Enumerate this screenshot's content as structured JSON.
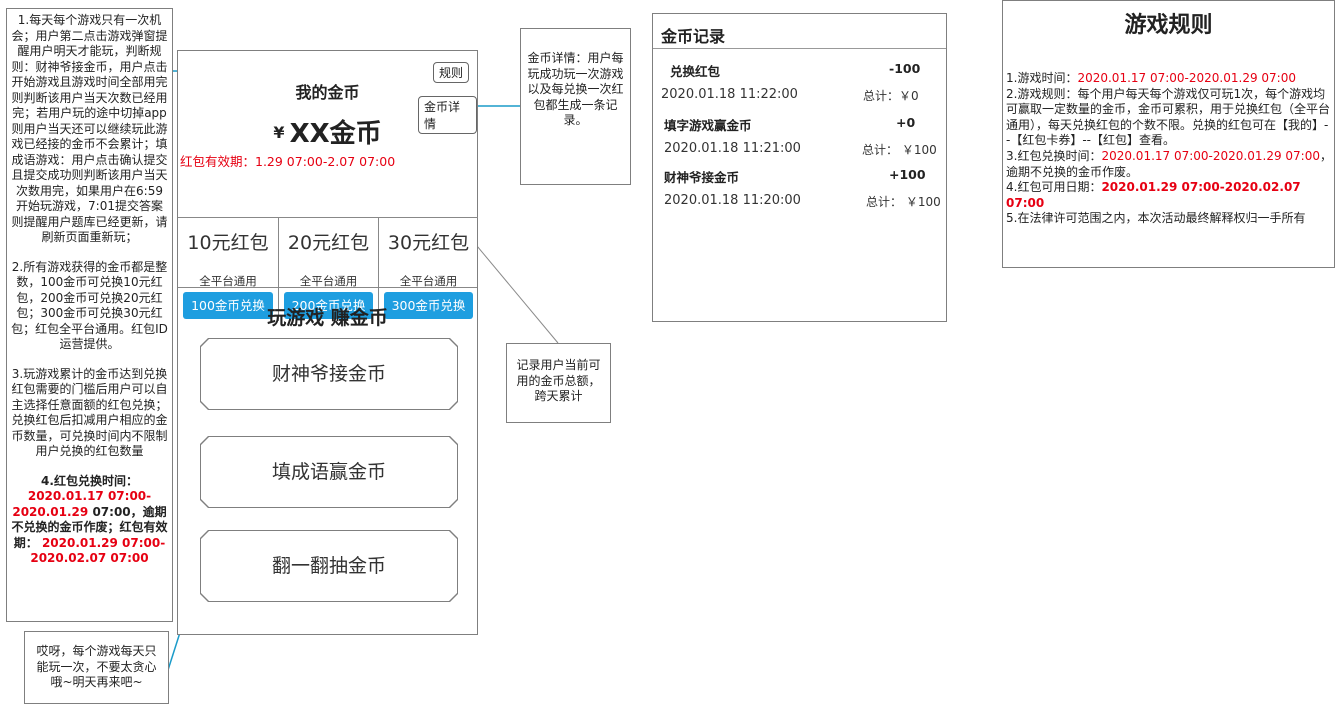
{
  "left_note": {
    "p1": "1.每天每个游戏只有一次机会；用户第二点击游戏弹窗提醒用户明天才能玩，判断规则：财神爷接金币，用户点击开始游戏且游戏时间全部用完则判断该用户当天次数已经用完；若用户玩的途中切掉app则用户当天还可以继续玩此游戏已经接的金币不会累计；填成语游戏：用户点击确认提交且提交成功则判断该用户当天次数用完，如果用户在6:59开始玩游戏，7:01提交答案则提醒用户题库已经更新，请刷新页面重新玩；",
    "p2": "2.所有游戏获得的金币都是整数，100金币可兑换10元红包，200金币可兑换20元红包；300金币可兑换30元红包；红包全平台通用。红包ID运营提供。",
    "p3": "3.玩游戏累计的金币达到兑换红包需要的门槛后用户可以自主选择任意面额的红包兑换；兑换红包后扣减用户相应的金币数量，可兑换时间内不限制用户兑换的红包数量",
    "p4_prefix": "4.红包兑换时间：",
    "p4_time": "2020.01.17 07:00-2020.01.29",
    "p4_mid": "07:00，逾期不兑换的金币作废；红包有效期：",
    "p4_valid": "2020.01.29 07:00-2020.02.07 07:00"
  },
  "bottom_note": "哎呀，每个游戏每天只能玩一次，不要太贪心哦~明天再来吧~",
  "coin_detail_note": "金币详情：用户每玩成功玩一次游戏以及每兑换一次红包都生成一条记录。",
  "total_note": "记录用户当前可用的金币总额，跨天累计",
  "phone": {
    "rules_btn": "规则",
    "detail_btn": "金币详情",
    "title": "我的金币",
    "currency": "¥",
    "amount": "XX金币",
    "validity": "红包有效期：1.29 07:00-2.07 07:00",
    "coupons": [
      {
        "amount": "10元红包",
        "scope": "全平台通用",
        "button": "100金币兑换"
      },
      {
        "amount": "20元红包",
        "scope": "全平台通用",
        "button": "200金币兑换"
      },
      {
        "amount": "30元红包",
        "scope": "全平台通用",
        "button": "300金币兑换"
      }
    ],
    "games_title": "玩游戏 赚金币",
    "games": [
      "财神爷接金币",
      "填成语赢金币",
      "翻一翻抽金币"
    ]
  },
  "records": {
    "title": "金币记录",
    "items": [
      {
        "name": "兑换红包",
        "value": "-100",
        "date": "2020.01.18 11:22:00",
        "total": "总计：￥0"
      },
      {
        "name": "填字游戏赢金币",
        "value": "+0",
        "date": "2020.01.18 11:21:00",
        "total": "总计： ￥100"
      },
      {
        "name": "财神爷接金币",
        "value": "+100",
        "date": "2020.01.18 11:20:00",
        "total": "总计： ￥100"
      }
    ]
  },
  "rules": {
    "title": "游戏规则",
    "r1_label": "1.游戏时间：",
    "r1_time": "2020.01.17 07:00-2020.01.29 07:00",
    "r2": "2.游戏规则：每个用户每天每个游戏仅可玩1次，每个游戏均可赢取一定数量的金币，金币可累积，用于兑换红包（全平台通用），每天兑换红包的个数不限。兑换的红包可在【我的】--【红包卡券】--【红包】查看。",
    "r3_label": "3.红包兑换时间：",
    "r3_time": "2020.01.17 07:00-2020.01.29 07:00",
    "r3_suffix": "，逾期不兑换的金币作废。",
    "r4_label": "4.红包可用日期：",
    "r4_time": "2020.01.29 07:00-2020.02.07 07:00",
    "r5": "5.在法律许可范围之内，本次活动最终解释权归一手所有"
  },
  "colors": {
    "accent": "#1e9ee0",
    "highlight_red": "#e60012",
    "connector": "#1a9bc9"
  }
}
